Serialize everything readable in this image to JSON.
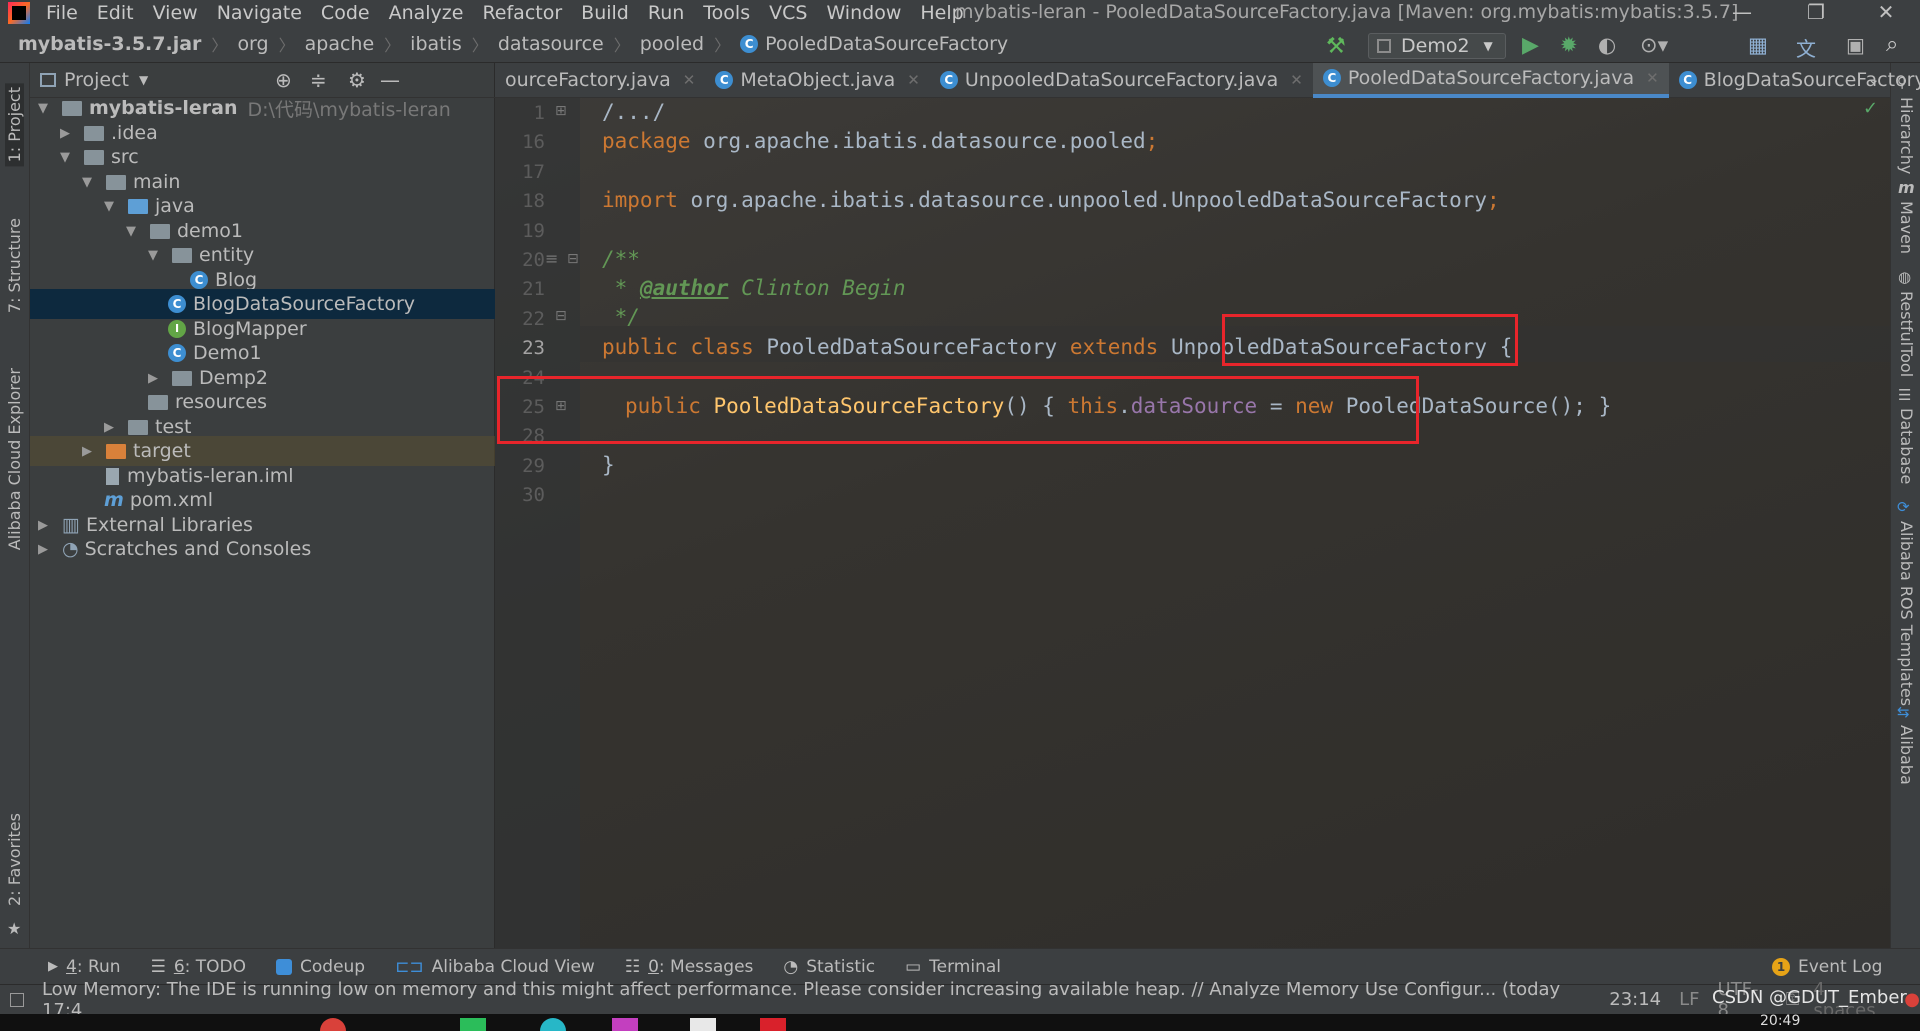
{
  "menu": {
    "items": [
      "File",
      "Edit",
      "View",
      "Navigate",
      "Code",
      "Analyze",
      "Refactor",
      "Build",
      "Run",
      "Tools",
      "VCS",
      "Window",
      "Help"
    ],
    "window_title": "mybatis-leran - PooledDataSourceFactory.java [Maven: org.mybatis:mybatis:3.5.7]"
  },
  "breadcrumb": {
    "items": [
      "mybatis-3.5.7.jar",
      "org",
      "apache",
      "ibatis",
      "datasource",
      "pooled",
      "PooledDataSourceFactory"
    ]
  },
  "toolbar": {
    "run_config": "Demo2"
  },
  "left_strip": {
    "project": "1: Project",
    "structure": "7: Structure",
    "alibaba": "Alibaba Cloud Explorer",
    "favorites": "2: Favorites"
  },
  "right_strip": {
    "hierarchy": "Hierarchy",
    "maven": "Maven",
    "restful": "RestfulTool",
    "database": "Database",
    "ros": "Alibaba ROS Templates",
    "alibaba": "Alibaba"
  },
  "project_panel": {
    "title": "Project",
    "tree": [
      {
        "label": "mybatis-leran",
        "extra": "D:\\代码\\mybatis-leran"
      },
      {
        "label": ".idea"
      },
      {
        "label": "src"
      },
      {
        "label": "main"
      },
      {
        "label": "java"
      },
      {
        "label": "demo1"
      },
      {
        "label": "entity"
      },
      {
        "label": "Blog"
      },
      {
        "label": "BlogDataSourceFactory"
      },
      {
        "label": "BlogMapper"
      },
      {
        "label": "Demo1"
      },
      {
        "label": "Demp2"
      },
      {
        "label": "resources"
      },
      {
        "label": "test"
      },
      {
        "label": "target"
      },
      {
        "label": "mybatis-leran.iml"
      },
      {
        "label": "pom.xml"
      },
      {
        "label": "External Libraries"
      },
      {
        "label": "Scratches and Consoles"
      }
    ]
  },
  "tabs": [
    {
      "label": "ourceFactory.java"
    },
    {
      "label": "MetaObject.java"
    },
    {
      "label": "UnpooledDataSourceFactory.java"
    },
    {
      "label": "PooledDataSourceFactory.java"
    },
    {
      "label": "BlogDataSourceFactory."
    }
  ],
  "editor": {
    "line_numbers": [
      "1",
      "16",
      "17",
      "18",
      "19",
      "20",
      "21",
      "22",
      "23",
      "24",
      "25",
      "28",
      "29",
      "30"
    ],
    "code": {
      "l1": "/.../",
      "l16_kw": "package",
      "l16_rest": " org.apache.ibatis.datasource.pooled",
      "l18_kw": "import",
      "l18_rest": " org.apache.ibatis.datasource.unpooled.UnpooledDataSourceFactory",
      "l20": "/**",
      "l21_star": " * ",
      "l21_tag": "@author",
      "l21_name": " Clinton Begin",
      "l22": " */",
      "l23_kw": "public class",
      "l23_name": "PooledDataSourceFactory",
      "l23_ext": "extends",
      "l23_super": "UnpooledDataSourceFactory",
      "l23_brace": "{",
      "l25_kw": "public",
      "l25_ctor": "PooledDataSourceFactory",
      "l25_paren": "() { ",
      "l25_this": "this",
      "l25_dot": ".",
      "l25_field": "dataSource",
      "l25_eq": " = ",
      "l25_new": "new",
      "l25_cls": " PooledDataSource",
      "l25_end": "(); }",
      "l29": "}",
      "semicolon": ";"
    }
  },
  "bottom_tools": [
    {
      "num": "4",
      "label": ": Run"
    },
    {
      "num": "6",
      "label": ": TODO"
    },
    {
      "label": "Codeup"
    },
    {
      "label": "Alibaba Cloud View"
    },
    {
      "num": "0",
      "label": ": Messages"
    },
    {
      "label": "Statistic"
    },
    {
      "label": "Terminal"
    }
  ],
  "event_log": {
    "count": "1",
    "label": "Event Log"
  },
  "status": {
    "message": "Low Memory: The IDE is running low on memory and this might affect performance. Please consider increasing available heap. // Analyze Memory Use   Configur... (today 17:4",
    "position": "23:14",
    "line_sep": "LF",
    "encoding": "UTF-8",
    "indent": "4 spaces",
    "watermark": "CSDN @GDUT_Ember",
    "clock": "20:49"
  },
  "colors": {
    "accent": "#4a88c7",
    "highlight_box": "#e8252b",
    "keyword": "#cc7832",
    "method": "#ffc66d",
    "field": "#9876aa",
    "comment": "#629755"
  }
}
